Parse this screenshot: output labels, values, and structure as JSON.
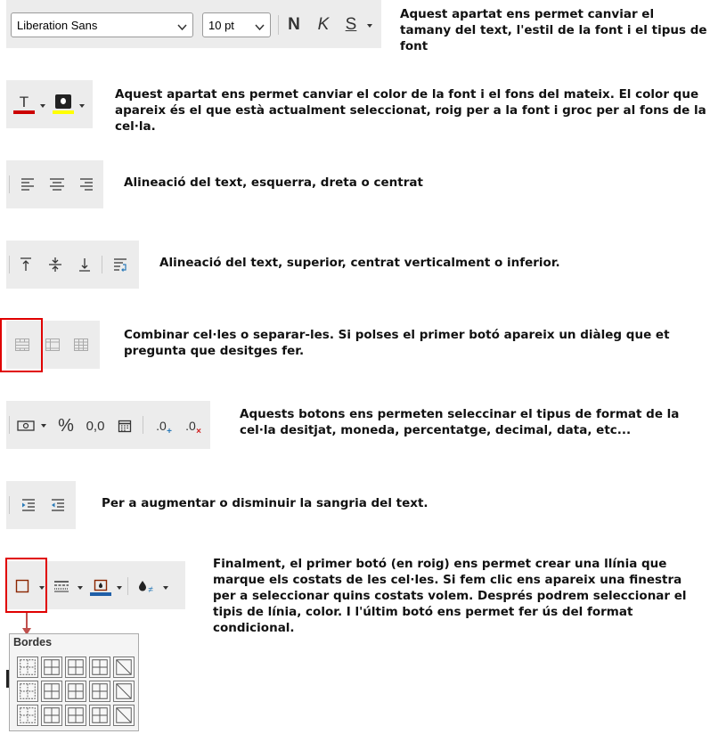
{
  "section1": {
    "font_name": "Liberation Sans",
    "font_size": "10 pt",
    "bold_glyph": "N",
    "italic_glyph": "K",
    "underline_glyph": "S",
    "description": "Aquest apartat ens permet canviar el tamany del text, l'estil de la font i el tipus de font"
  },
  "section2": {
    "font_color_glyph": "T",
    "font_color": "#cc0000",
    "highlight_color": "#ffff00",
    "description": "Aquest apartat ens permet canviar el color de la font i el fons del mateix. El color que apareix és el que està actualment seleccionat, roig per a la font i groc per al fons de la cel·la."
  },
  "section3": {
    "description": "Alineació del text, esquerra, dreta o centrat"
  },
  "section4": {
    "description": "Alineació del text, superior, centrat verticalment o inferior."
  },
  "section5": {
    "description": "Combinar cel·les o separar-les. Si polses el primer botó apareix un diàleg que et pregunta que desitges fer."
  },
  "section6": {
    "percent_glyph": "%",
    "decimal_glyph": "0,0",
    "add_decimal_glyph": ".0",
    "remove_decimal_glyph": ".0",
    "description": "Aquests botons ens permeten seleccinar el tipus de format de la cel·la desitjat, moneda, percentatge, decimal, data, etc..."
  },
  "section7": {
    "description": "Per a augmentar o disminuir la sangria del text."
  },
  "section8": {
    "border_color": "#1f5fa8",
    "cond_glyph": "≠",
    "description": "Finalment, el primer botó (en roig) ens permet crear una llínia que marque els costats de les cel·les. Si fem clic ens apareix una finestra per a seleccionar quins costats volem. Després podrem seleccionar el tipis de línia, color. I l'últim botó ens permet fer ús del format condicional.",
    "popup_title": "Bordes"
  }
}
